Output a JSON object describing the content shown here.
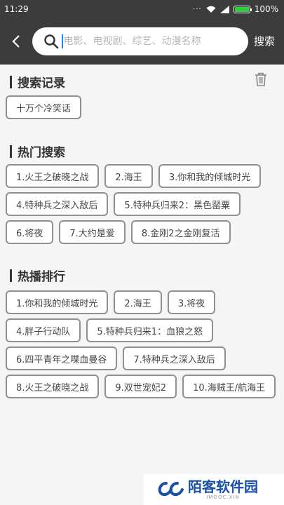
{
  "status": {
    "time": "11:29",
    "battery": "100%",
    "battery_level": 1.0
  },
  "search": {
    "placeholder": "电影、电视剧、综艺、动漫名称",
    "button": "搜索"
  },
  "history": {
    "title": "搜索记录",
    "items": [
      "十万个冷笑话"
    ]
  },
  "hot": {
    "title": "热门搜索",
    "items": [
      "1.火王之破晓之战",
      "2.海王",
      "3.你和我的倾城时光",
      "4.特种兵之深入敌后",
      "5.特种兵归来2：黑色罂粟",
      "6.将夜",
      "7.大约是爱",
      "8.金刚2之金刚复活"
    ]
  },
  "ranking": {
    "title": "热播排行",
    "items": [
      "1.你和我的倾城时光",
      "2.海王",
      "3.将夜",
      "4.胖子行动队",
      "5.特种兵归来1：血狼之怒",
      "6.四平青年之喋血曼谷",
      "7.特种兵之深入敌后",
      "8.火王之破晓之战",
      "9.双世宠妃2",
      "10.海贼王/航海王"
    ]
  },
  "watermark": {
    "name": "陌客软件园",
    "domain": "IMOOC.XIN"
  },
  "colors": {
    "header": "#3c3c3c",
    "battery": "#2ecc40",
    "logo": "#1a4fa8"
  }
}
